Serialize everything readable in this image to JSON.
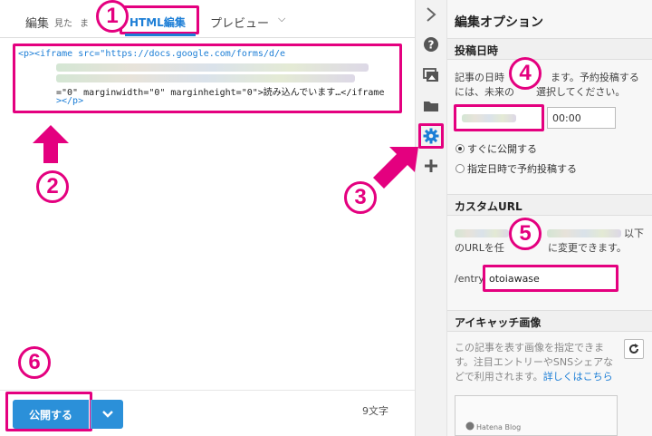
{
  "editor": {
    "tab_edit": "編集",
    "tab_see": "見た",
    "tab_ma": "ま",
    "tab_html": "HTML編集",
    "tab_preview": "プレビュー",
    "code_line1": "<p><iframe src=\"https://docs.google.com/forms/d/e",
    "code_line4": "=\"0\" marginwidth=\"0\" marginheight=\"0\">読み込んでいます…</iframe",
    "code_line5": "></p>",
    "publish_label": "公開する",
    "char_count": "9文字"
  },
  "panel": {
    "title": "編集オプション",
    "post_date": {
      "heading": "投稿日時",
      "desc_part1": "記事の日時",
      "desc_part2": "ます。予約投稿する",
      "desc_part3": "には、未来の",
      "desc_part4": "選択してください。",
      "time_value": "00:00",
      "radio_now": "すぐに公開する",
      "radio_schedule": "指定日時で予約投稿する"
    },
    "custom_url": {
      "heading": "カスタムURL",
      "desc_part1": "以下",
      "desc_part2": "のURLを任",
      "desc_part3": "に変更できます。",
      "prefix": "/entry/",
      "slug_value": "otoiawase"
    },
    "eyecatch": {
      "heading": "アイキャッチ画像",
      "desc_line1": "この記事を表す画像を指定できま",
      "desc_line2": "す。注目エントリーやSNSシェアな",
      "desc_line3": "どで利用されます。",
      "link": "詳しくはこちら",
      "thumb_label": "Hatena Blog"
    }
  },
  "callouts": [
    "1",
    "2",
    "3",
    "4",
    "5",
    "6"
  ],
  "colors": {
    "highlight": "#e4007f",
    "accent_blue": "#2b90d9"
  }
}
